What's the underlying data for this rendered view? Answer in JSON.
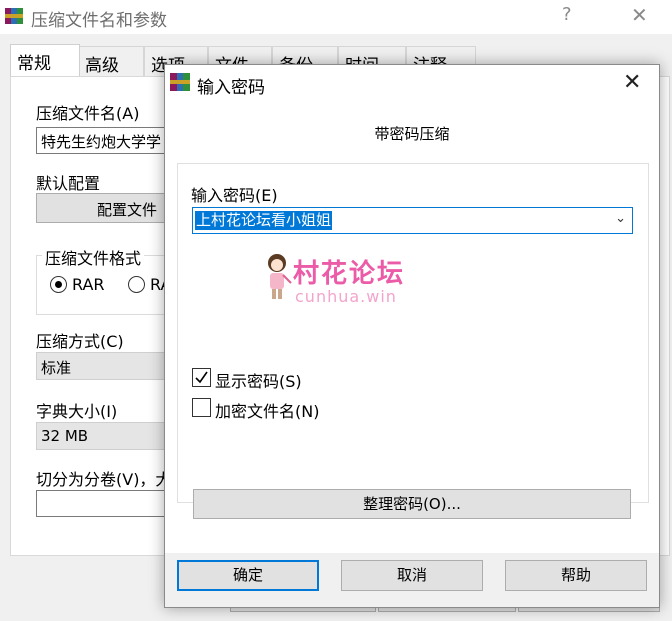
{
  "back_window": {
    "title": "压缩文件名和参数",
    "help_glyph": "?",
    "close_glyph": "✕",
    "tabs": [
      "常规",
      "高级",
      "选项",
      "文件",
      "备份",
      "时间",
      "注释"
    ],
    "archive_name_label": "压缩文件名(A)",
    "archive_name_value": "特先生约炮大学学",
    "default_profile_label": "默认配置",
    "profiles_button": "配置文件",
    "format_group_title": "压缩文件格式",
    "format_options": [
      "RAR",
      "RAR"
    ],
    "method_label": "压缩方式(C)",
    "method_value": "标准",
    "dict_label": "字典大小(I)",
    "dict_value": "32 MB",
    "split_label": "切分为分卷(V)，大"
  },
  "dialog": {
    "title": "输入密码",
    "close_glyph": "✕",
    "subtitle": "带密码压缩",
    "password_label": "输入密码(E)",
    "password_value": "上村花论坛看小姐姐",
    "dropdown_glyph": "⌄",
    "watermark_cn": "村花论坛",
    "watermark_en": "cunhua.win",
    "show_password_label": "显示密码(S)",
    "show_password_checked": true,
    "encrypt_names_label": "加密文件名(N)",
    "encrypt_names_checked": false,
    "organize_button": "整理密码(O)...",
    "ok_button": "确定",
    "cancel_button": "取消",
    "help_button": "帮助"
  },
  "colors": {
    "accent": "#0078d7",
    "watermark_pink": "#ec5ba8"
  }
}
